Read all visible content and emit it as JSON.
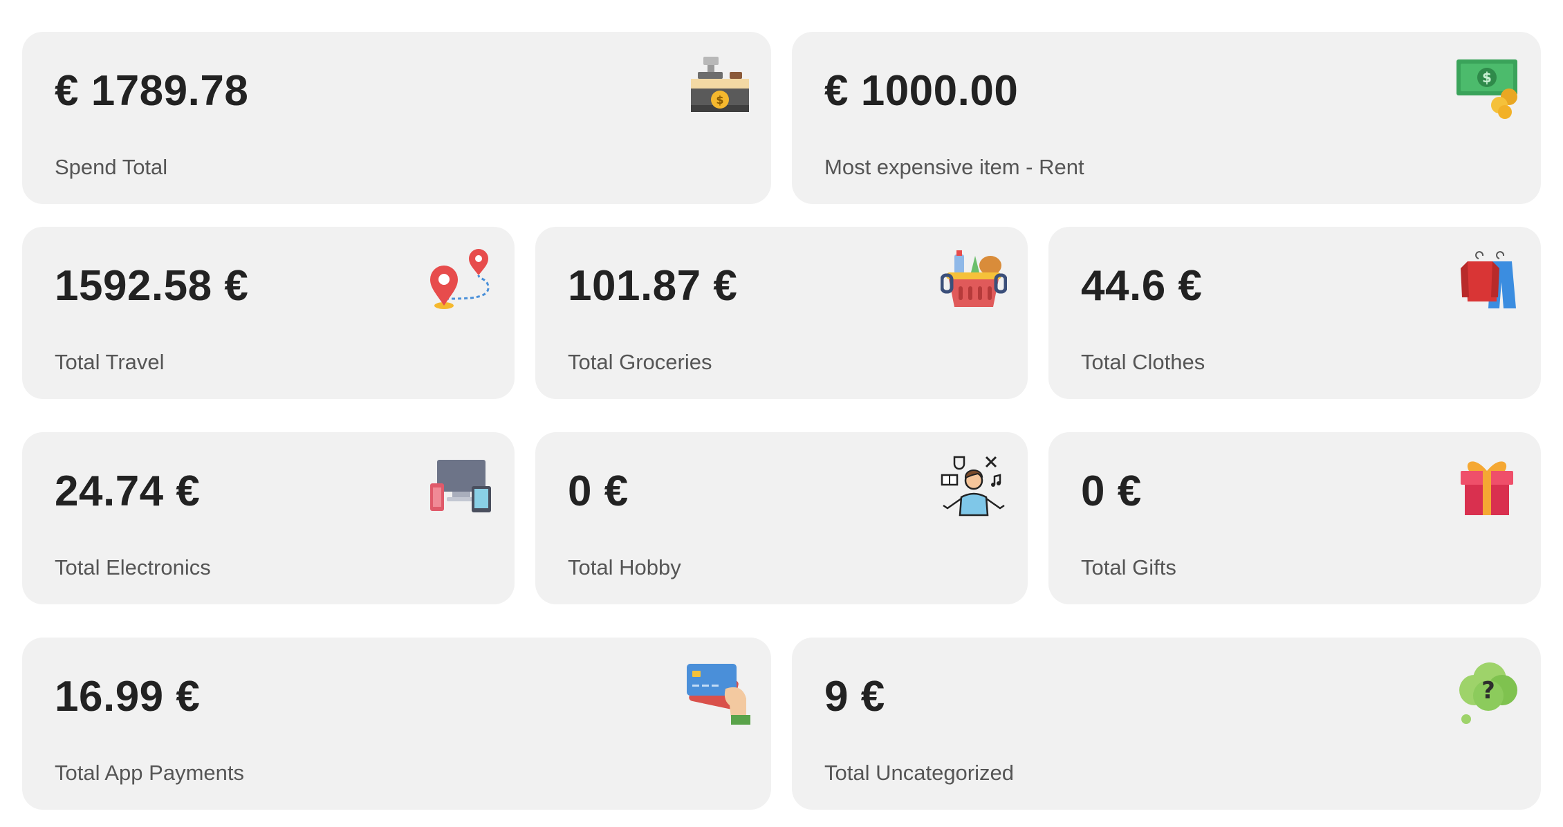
{
  "cards": [
    {
      "value": "€ 1789.78",
      "label": "Spend Total",
      "icon": "cash-register-icon"
    },
    {
      "value": "€ 1000.00",
      "label": "Most expensive item - Rent",
      "icon": "banknote-coins-icon"
    },
    {
      "value": "1592.58 €",
      "label": "Total Travel",
      "icon": "route-pins-icon"
    },
    {
      "value": "101.87 €",
      "label": "Total Groceries",
      "icon": "grocery-basket-icon"
    },
    {
      "value": "44.6 €",
      "label": "Total Clothes",
      "icon": "clothes-hangers-icon"
    },
    {
      "value": "24.74 €",
      "label": "Total Electronics",
      "icon": "devices-icon"
    },
    {
      "value": "0 €",
      "label": "Total Hobby",
      "icon": "hobby-person-icon"
    },
    {
      "value": "0 €",
      "label": "Total Gifts",
      "icon": "gift-box-icon"
    },
    {
      "value": "16.99 €",
      "label": "Total App Payments",
      "icon": "credit-card-hand-icon"
    },
    {
      "value": "9 €",
      "label": "Total Uncategorized",
      "icon": "question-bubble-icon"
    }
  ]
}
